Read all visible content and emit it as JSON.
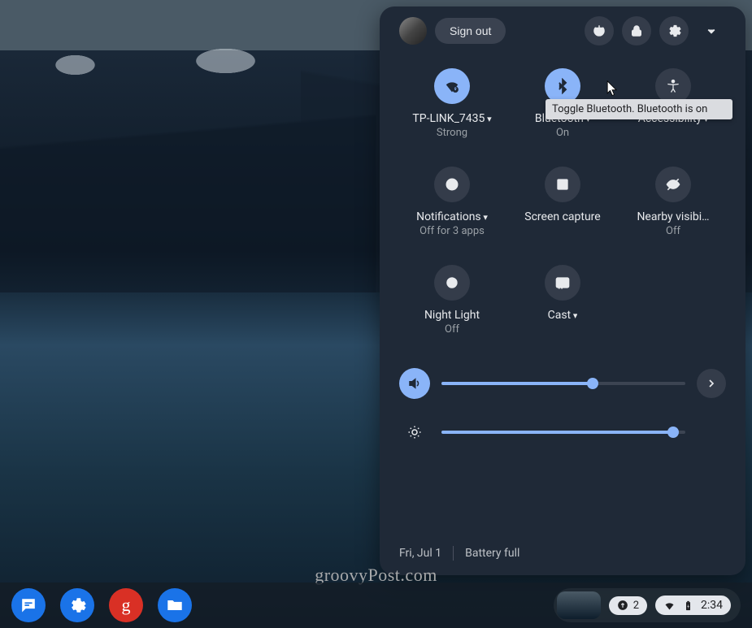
{
  "header": {
    "signout_label": "Sign out"
  },
  "tiles": {
    "wifi": {
      "label": "TP-LINK_7435",
      "sub": "Strong",
      "has_caret": true,
      "active": true
    },
    "bluetooth": {
      "label": "Bluetooth",
      "sub": "On",
      "has_caret": true,
      "active": true
    },
    "accessibility": {
      "label": "Accessibility",
      "sub": "",
      "has_caret": true,
      "active": false
    },
    "notifications": {
      "label": "Notifications",
      "sub": "Off for 3 apps",
      "has_caret": true,
      "active": false
    },
    "screencap": {
      "label": "Screen capture",
      "sub": "",
      "has_caret": false,
      "active": false
    },
    "nearby": {
      "label": "Nearby visibi…",
      "sub": "Off",
      "has_caret": false,
      "active": false
    },
    "nightlight": {
      "label": "Night Light",
      "sub": "Off",
      "has_caret": false,
      "active": false
    },
    "cast": {
      "label": "Cast",
      "sub": "",
      "has_caret": true,
      "active": false
    }
  },
  "tooltip": "Toggle Bluetooth. Bluetooth is on",
  "sliders": {
    "volume_pct": 62,
    "brightness_pct": 95
  },
  "footer": {
    "date": "Fri, Jul 1",
    "battery": "Battery full"
  },
  "shelf": {
    "g_letter": "g",
    "notif_count": "2",
    "clock": "2:34"
  },
  "watermark": "groovyPost.com"
}
